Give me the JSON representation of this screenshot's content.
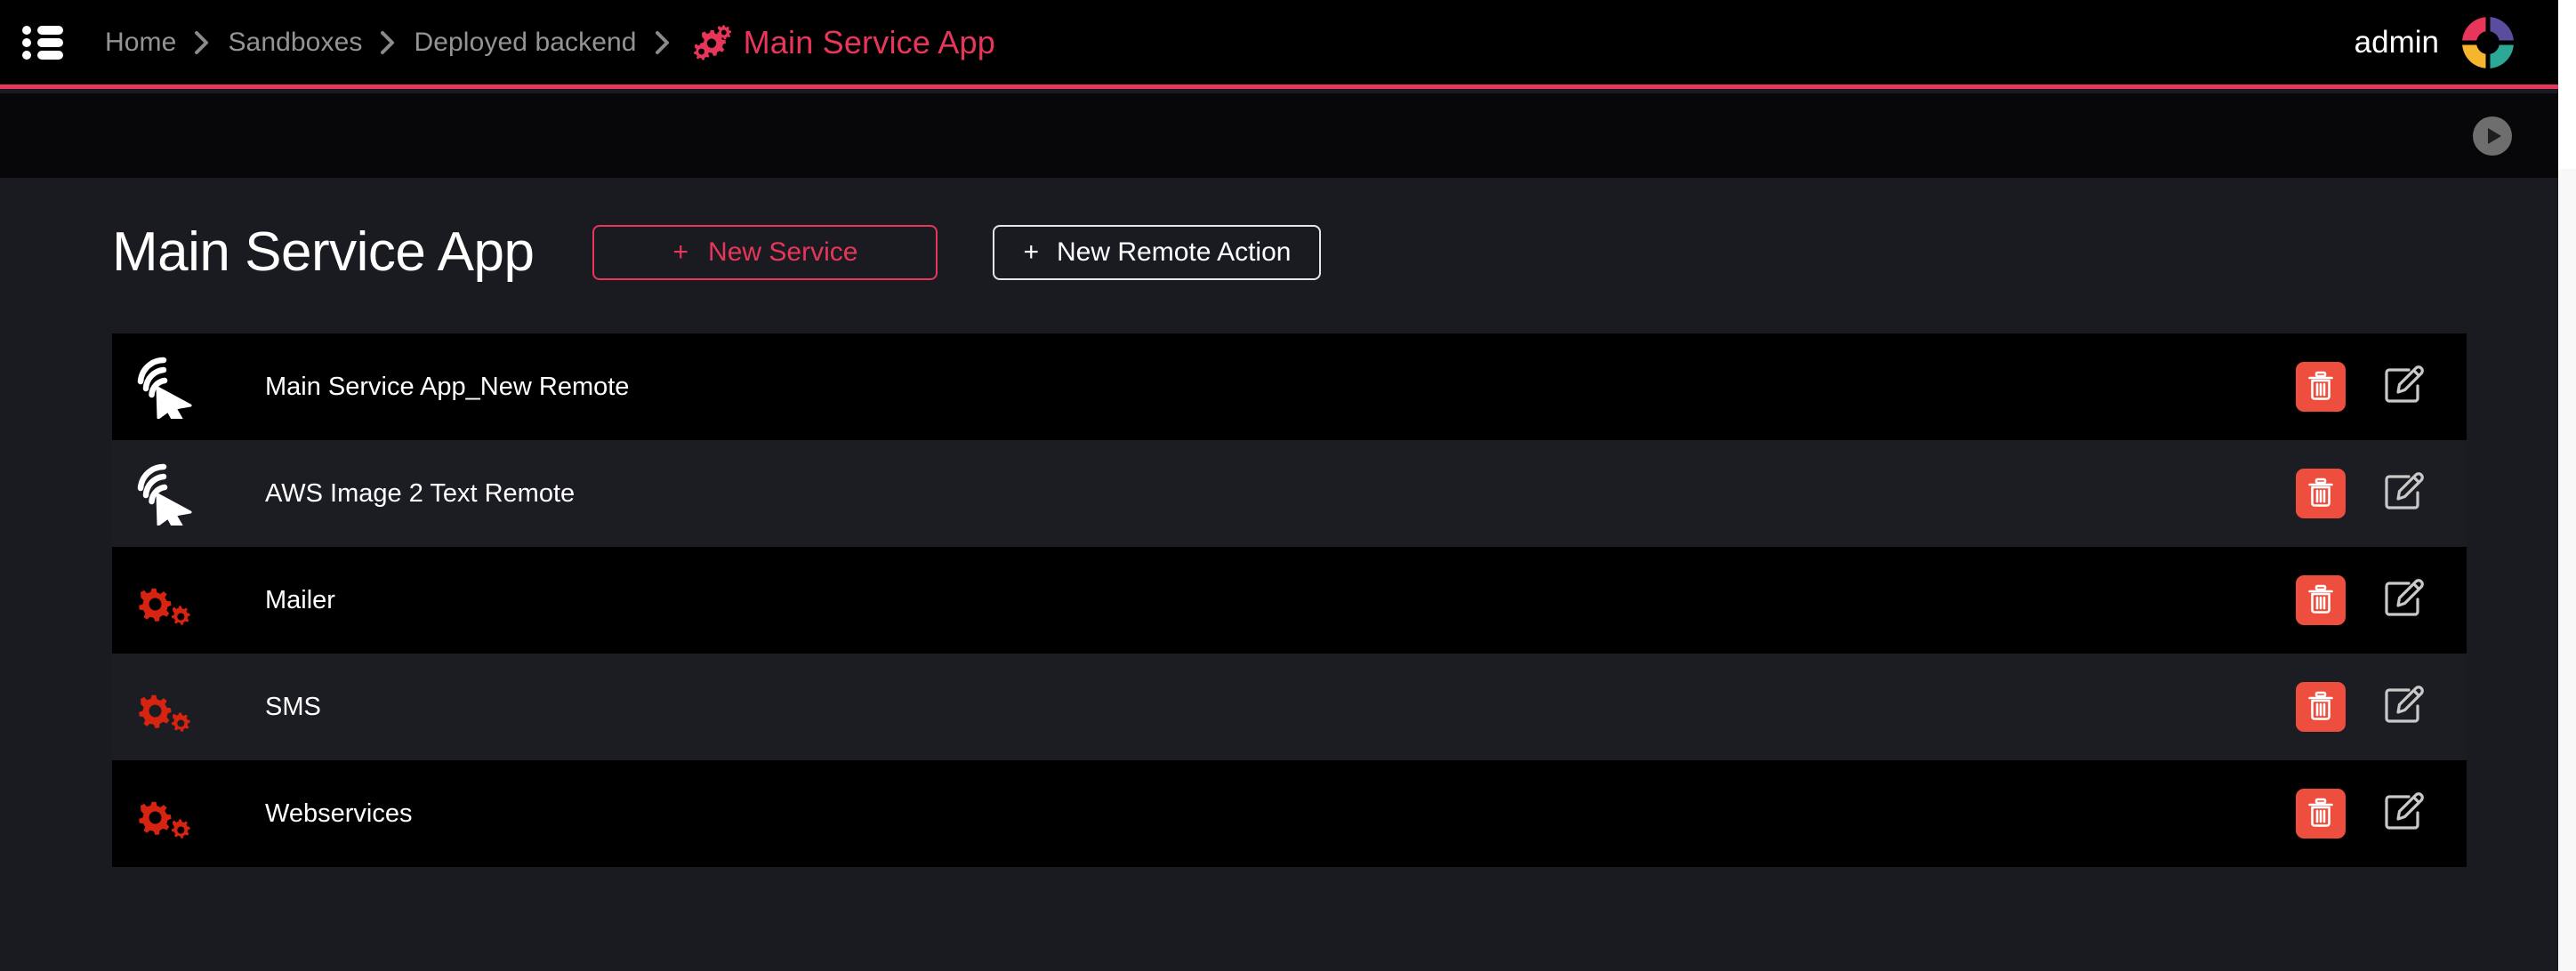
{
  "header": {
    "menu_icon": "list-menu-icon",
    "breadcrumb": [
      {
        "label": "Home",
        "current": false
      },
      {
        "label": "Sandboxes",
        "current": false
      },
      {
        "label": "Deployed backend",
        "current": false
      },
      {
        "label": "Main Service App",
        "current": true,
        "icon": "gears-icon"
      }
    ],
    "separator": "›",
    "user": {
      "name": "admin",
      "avatar_icon": "donut-avatar-icon",
      "avatar_colors": [
        "#E8365A",
        "#5B4D9E",
        "#2DA896",
        "#F5B52E"
      ]
    }
  },
  "subbar": {
    "play_icon": "play-circle-icon",
    "play_color": "#6E6E6E"
  },
  "main": {
    "title": "Main Service App",
    "buttons": {
      "new_service": {
        "plus": "+",
        "label": "New Service",
        "color": "#E8365A"
      },
      "new_remote_action": {
        "plus": "+",
        "label": "New Remote Action",
        "color": "#FFFFFF"
      }
    }
  },
  "list": {
    "delete_icon": "trash-icon",
    "edit_icon": "pencil-square-icon",
    "rows": [
      {
        "label": "Main Service App_New Remote",
        "icon": "remote-cursor-icon",
        "stripe": "dark"
      },
      {
        "label": "AWS Image 2 Text Remote",
        "icon": "remote-cursor-icon",
        "stripe": "light"
      },
      {
        "label": "Mailer",
        "icon": "gears-red-icon",
        "stripe": "dark"
      },
      {
        "label": "SMS",
        "icon": "gears-red-icon",
        "stripe": "light"
      },
      {
        "label": "Webservices",
        "icon": "gears-red-icon",
        "stripe": "dark"
      }
    ]
  },
  "colors": {
    "accent": "#E8365A",
    "danger": "#EE4E3E",
    "gear_red": "#D62411",
    "page_bg": "#1A1B20",
    "header_bg": "#000000",
    "row_dark": "#000000",
    "row_light": "#1C1D22",
    "muted_text": "#949494"
  }
}
